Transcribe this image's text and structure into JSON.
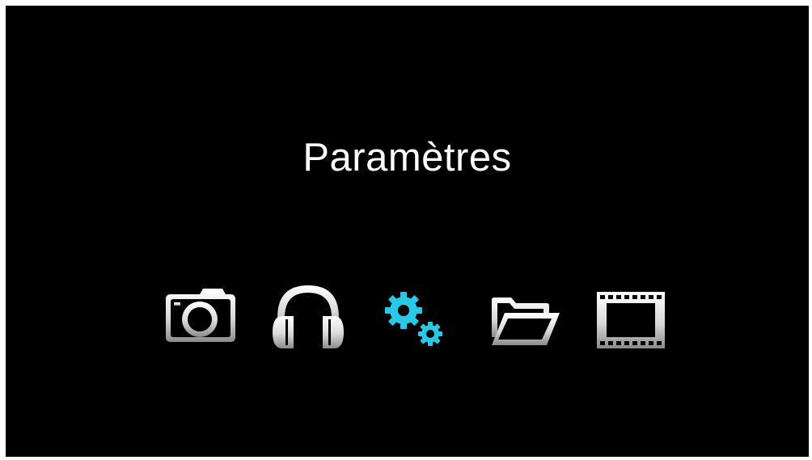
{
  "screen": {
    "title": "Paramètres",
    "background": "#000000",
    "title_color": "#ffffff"
  },
  "menu": {
    "selected_color": "#29c8e6",
    "items": [
      {
        "icon": "camera-icon",
        "selected": false
      },
      {
        "icon": "headphones-icon",
        "selected": false
      },
      {
        "icon": "gears-icon",
        "selected": true
      },
      {
        "icon": "folder-icon",
        "selected": false
      },
      {
        "icon": "film-icon",
        "selected": false
      }
    ]
  }
}
